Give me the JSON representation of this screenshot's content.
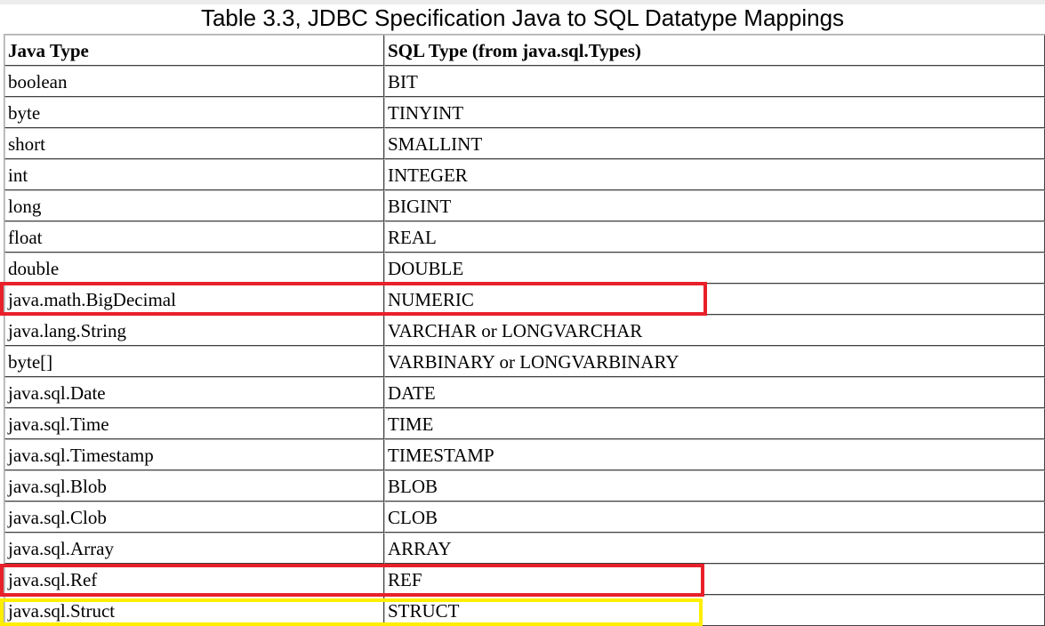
{
  "title": "Table 3.3, JDBC Specification Java to SQL Datatype Mappings",
  "table": {
    "headers": [
      "Java Type",
      "SQL Type (from java.sql.Types)"
    ],
    "rows": [
      [
        "boolean",
        "BIT"
      ],
      [
        "byte",
        "TINYINT"
      ],
      [
        "short",
        "SMALLINT"
      ],
      [
        "int",
        "INTEGER"
      ],
      [
        "long",
        "BIGINT"
      ],
      [
        "float",
        "REAL"
      ],
      [
        "double",
        "DOUBLE"
      ],
      [
        "java.math.BigDecimal",
        "NUMERIC"
      ],
      [
        "java.lang.String",
        "VARCHAR or LONGVARCHAR"
      ],
      [
        "byte[]",
        "VARBINARY or LONGVARBINARY"
      ],
      [
        "java.sql.Date",
        "DATE"
      ],
      [
        "java.sql.Time",
        "TIME"
      ],
      [
        "java.sql.Timestamp",
        "TIMESTAMP"
      ],
      [
        "java.sql.Blob",
        "BLOB"
      ],
      [
        "java.sql.Clob",
        "CLOB"
      ],
      [
        "java.sql.Array",
        "ARRAY"
      ],
      [
        "java.sql.Ref",
        "REF"
      ],
      [
        "java.sql.Struct",
        "STRUCT"
      ]
    ]
  },
  "highlights": [
    {
      "row": "java.math.BigDecimal",
      "color": "#e8202a"
    },
    {
      "row": "java.sql.Ref",
      "color": "#e8202a"
    },
    {
      "row": "java.sql.Struct",
      "color": "#ffee00"
    }
  ]
}
